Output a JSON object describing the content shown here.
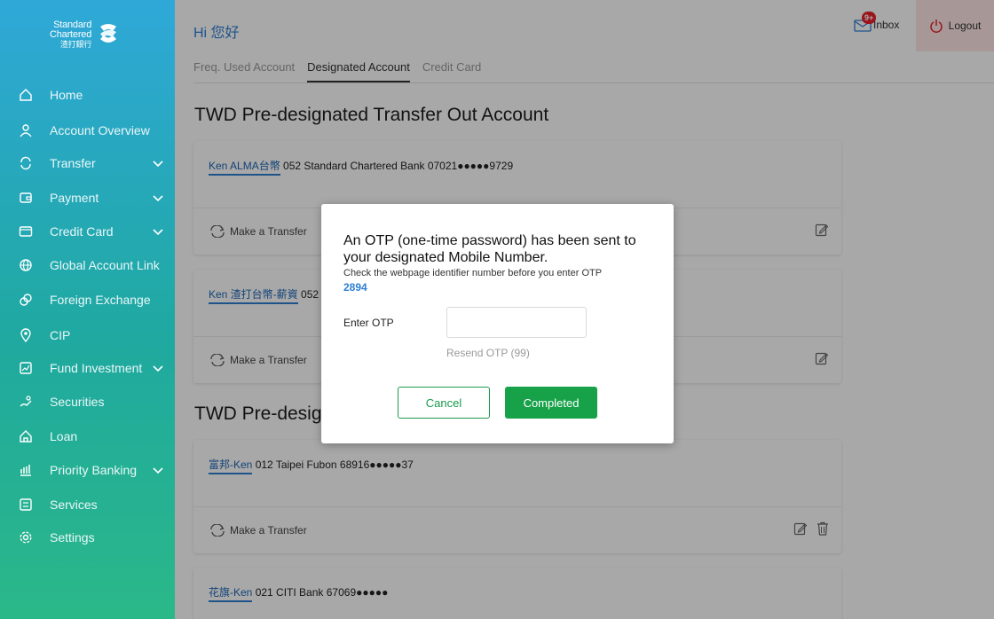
{
  "brand": {
    "line1": "Standard",
    "line2": "Chartered",
    "line3": "渣打銀行"
  },
  "sidebar": {
    "items": [
      {
        "label": "Home",
        "icon": "home-icon",
        "chevron": false
      },
      {
        "label": "Account Overview",
        "icon": "person-icon",
        "chevron": false
      },
      {
        "label": "Transfer",
        "icon": "transfer-icon",
        "chevron": true
      },
      {
        "label": "Payment",
        "icon": "wallet-icon",
        "chevron": true
      },
      {
        "label": "Credit Card",
        "icon": "credit-card-icon",
        "chevron": true
      },
      {
        "label": "Global Account Link",
        "icon": "globe-icon",
        "chevron": false
      },
      {
        "label": "Foreign Exchange",
        "icon": "exchange-icon",
        "chevron": false
      },
      {
        "label": "CIP",
        "icon": "location-icon",
        "chevron": false
      },
      {
        "label": "Fund Investment",
        "icon": "chart-icon",
        "chevron": true
      },
      {
        "label": "Securities",
        "icon": "securities-icon",
        "chevron": false
      },
      {
        "label": "Loan",
        "icon": "house-icon",
        "chevron": false
      },
      {
        "label": "Priority Banking",
        "icon": "bank-icon",
        "chevron": true
      },
      {
        "label": "Services",
        "icon": "services-icon",
        "chevron": false
      },
      {
        "label": "Settings",
        "icon": "gear-icon",
        "chevron": false
      }
    ]
  },
  "header": {
    "greeting": "Hi 您好",
    "inbox_label": "Inbox",
    "inbox_badge": "9+",
    "logout_label": "Logout"
  },
  "tabs": [
    {
      "label": "Freq. Used Account",
      "active": false
    },
    {
      "label": "Designated Account",
      "active": true
    },
    {
      "label": "Credit Card",
      "active": false
    }
  ],
  "sections": [
    {
      "title": "TWD Pre-designated Transfer Out Account"
    },
    {
      "title": "TWD Pre-desig"
    }
  ],
  "accounts": [
    {
      "nickname": "Ken ALMA台幣",
      "detail": "052 Standard Chartered Bank 07021●●●●●9729",
      "action": "Make a Transfer"
    },
    {
      "nickname": "Ken 渣打台幣-薪資",
      "detail": "052",
      "action": "Make a Transfer"
    },
    {
      "nickname": "富邦-Ken",
      "detail": "012 Taipei Fubon 68916●●●●●37",
      "action": "Make a Transfer"
    },
    {
      "nickname": "花旗-Ken",
      "detail": "021 CITI Bank 67069●●●●●",
      "action": ""
    }
  ],
  "modal": {
    "title": "An OTP (one-time password) has been sent to your designated Mobile Number.",
    "subtitle": "Check the webpage identifier number before you enter OTP",
    "identifier": "2894",
    "otp_label": "Enter OTP",
    "otp_value": "",
    "resend_label": "Resend OTP (99)",
    "cancel_label": "Cancel",
    "complete_label": "Completed"
  }
}
